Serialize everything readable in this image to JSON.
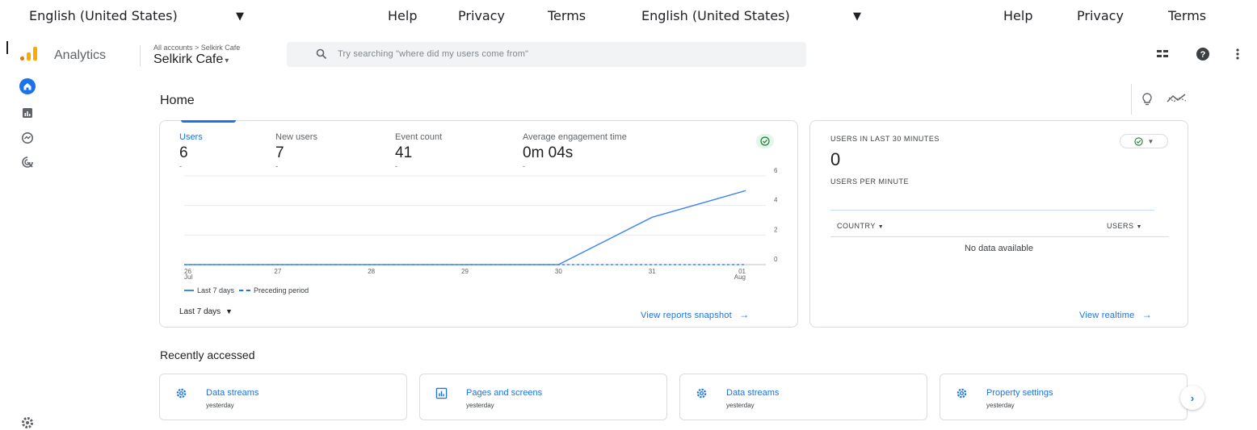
{
  "topbar": {
    "lang_1": "English (United States)",
    "help_1": "Help",
    "privacy_1": "Privacy",
    "terms_1": "Terms",
    "lang_2": "English (United States)",
    "help_2": "Help",
    "privacy_2": "Privacy",
    "terms_2": "Terms"
  },
  "header": {
    "app_name": "Analytics",
    "breadcrumb": "All accounts > Selkirk Cafe",
    "account_name": "Selkirk Cafe",
    "search_placeholder": "Try searching \"where did my users come from\""
  },
  "home": {
    "title": "Home"
  },
  "metrics": [
    {
      "label": "Users",
      "value": "6",
      "delta": "-"
    },
    {
      "label": "New users",
      "value": "7",
      "delta": "-"
    },
    {
      "label": "Event count",
      "value": "41",
      "delta": "-"
    },
    {
      "label": "Average engagement time",
      "value": "0m 04s",
      "delta": "-"
    }
  ],
  "chart_data": {
    "type": "line",
    "x": [
      "26 Jul",
      "27",
      "28",
      "29",
      "30",
      "31",
      "01 Aug"
    ],
    "x_tick_lines": [
      [
        "26",
        "Jul"
      ],
      [
        "27"
      ],
      [
        "28"
      ],
      [
        "29"
      ],
      [
        "30"
      ],
      [
        "31"
      ],
      [
        "01",
        "Aug"
      ]
    ],
    "series": [
      {
        "name": "Last 7 days",
        "values": [
          0,
          0,
          0,
          0,
          0,
          3.2,
          5.0
        ],
        "color": "#4285f4",
        "style": "solid"
      },
      {
        "name": "Preceding period",
        "values": [
          0,
          0,
          0,
          0,
          0,
          0,
          0
        ],
        "color": "#4285f4",
        "style": "dashed"
      }
    ],
    "y_ticks": [
      "0",
      "2",
      "4",
      "6"
    ],
    "ylim": [
      0,
      6
    ],
    "grid": true,
    "legend_position": "bottom-left"
  },
  "main_card": {
    "range_label": "Last 7 days",
    "view_link": "View reports snapshot"
  },
  "realtime": {
    "title": "USERS IN LAST 30 MINUTES",
    "value": "0",
    "subtitle": "USERS PER MINUTE",
    "col_country": "COUNTRY",
    "col_users": "USERS",
    "no_data": "No data available",
    "view_link": "View realtime"
  },
  "recent": {
    "title": "Recently accessed",
    "items": [
      {
        "title": "Data streams",
        "sub": "yesterday",
        "icon": "gear-icon"
      },
      {
        "title": "Pages and screens",
        "sub": "yesterday",
        "icon": "report-icon"
      },
      {
        "title": "Data streams",
        "sub": "yesterday",
        "icon": "gear-icon"
      },
      {
        "title": "Property settings",
        "sub": "yesterday",
        "icon": "gear-icon"
      }
    ]
  },
  "colors": {
    "accent": "#1a73e8",
    "logo_orange": "#f9ab00",
    "logo_dark_orange": "#e37400"
  }
}
